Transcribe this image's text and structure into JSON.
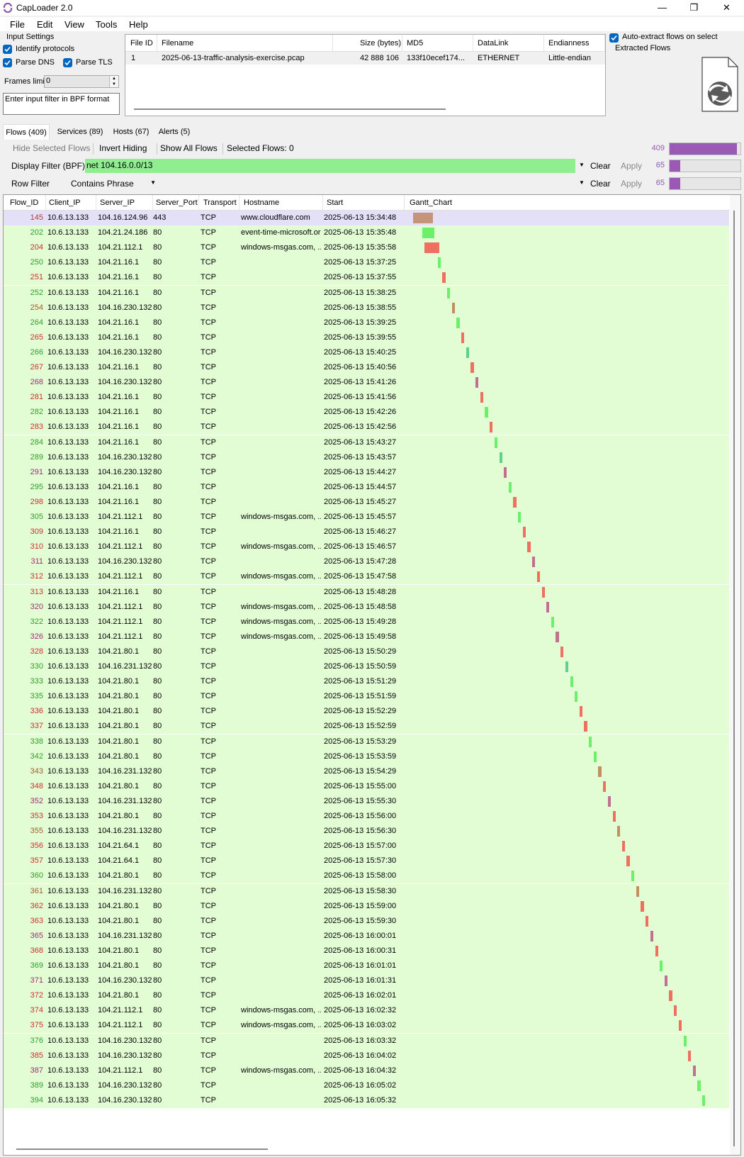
{
  "app": {
    "title": "CapLoader 2.0"
  },
  "window_controls": {
    "minimize": "—",
    "maximize": "❐",
    "close": "✕"
  },
  "menu": [
    "File",
    "Edit",
    "View",
    "Tools",
    "Help"
  ],
  "input_settings": {
    "title": "Input Settings",
    "identify_protocols": "Identify protocols",
    "parse_dns": "Parse DNS",
    "parse_tls": "Parse TLS",
    "frames_limit_label": "Frames limit",
    "frames_limit_value": "0",
    "bpf_placeholder": "Enter input filter in BPF format"
  },
  "file_table": {
    "headers": [
      "File ID",
      "Filename",
      "Size (bytes)",
      "MD5",
      "DataLink",
      "Endianness"
    ],
    "rows": [
      [
        "1",
        "2025-06-13-traffic-analysis-exercise.pcap",
        "42 888 106",
        "133f10ecef174...",
        "ETHERNET",
        "Little-endian"
      ]
    ]
  },
  "auto_extract": {
    "label": "Auto-extract flows on select",
    "extracted_label": "Extracted Flows"
  },
  "tabs": [
    "Flows (409)",
    "Services (89)",
    "Hosts (67)",
    "Alerts (5)"
  ],
  "toolbar": {
    "hide_selected": "Hide Selected Flows",
    "invert_hiding": "Invert Hiding",
    "show_all": "Show All Flows",
    "selected_flows": "Selected Flows:  0",
    "total_count": "409",
    "total_fraction": 0.95
  },
  "display_filter": {
    "label": "Display Filter (BPF)",
    "value": "net 104.16.0.0/13",
    "clear": "Clear",
    "apply": "Apply",
    "count": "65",
    "fraction": 0.15
  },
  "row_filter": {
    "label": "Row Filter",
    "mode": "Contains Phrase",
    "clear": "Clear",
    "apply": "Apply",
    "count": "65",
    "fraction": 0.15
  },
  "flows_table": {
    "headers": [
      "Flow_ID",
      "Client_IP",
      "Server_IP",
      "Server_Port",
      "Transport",
      "Hostname",
      "Start",
      "Gantt_Chart"
    ],
    "rows": [
      [
        "145",
        "10.6.13.133",
        "104.16.124.96",
        "443",
        "TCP",
        "www.cloudflare.com",
        "2025-06-13 15:34:48"
      ],
      [
        "202",
        "10.6.13.133",
        "104.21.24.186",
        "80",
        "TCP",
        "event-time-microsoft.org",
        "2025-06-13 15:35:48"
      ],
      [
        "204",
        "10.6.13.133",
        "104.21.112.1",
        "80",
        "TCP",
        "windows-msgas.com, ...",
        "2025-06-13 15:35:58"
      ],
      [
        "250",
        "10.6.13.133",
        "104.21.16.1",
        "80",
        "TCP",
        "",
        "2025-06-13 15:37:25"
      ],
      [
        "251",
        "10.6.13.133",
        "104.21.16.1",
        "80",
        "TCP",
        "",
        "2025-06-13 15:37:55"
      ],
      [
        "252",
        "10.6.13.133",
        "104.21.16.1",
        "80",
        "TCP",
        "",
        "2025-06-13 15:38:25"
      ],
      [
        "254",
        "10.6.13.133",
        "104.16.230.132",
        "80",
        "TCP",
        "",
        "2025-06-13 15:38:55"
      ],
      [
        "264",
        "10.6.13.133",
        "104.21.16.1",
        "80",
        "TCP",
        "",
        "2025-06-13 15:39:25"
      ],
      [
        "265",
        "10.6.13.133",
        "104.21.16.1",
        "80",
        "TCP",
        "",
        "2025-06-13 15:39:55"
      ],
      [
        "266",
        "10.6.13.133",
        "104.16.230.132",
        "80",
        "TCP",
        "",
        "2025-06-13 15:40:25"
      ],
      [
        "267",
        "10.6.13.133",
        "104.21.16.1",
        "80",
        "TCP",
        "",
        "2025-06-13 15:40:56"
      ],
      [
        "268",
        "10.6.13.133",
        "104.16.230.132",
        "80",
        "TCP",
        "",
        "2025-06-13 15:41:26"
      ],
      [
        "281",
        "10.6.13.133",
        "104.21.16.1",
        "80",
        "TCP",
        "",
        "2025-06-13 15:41:56"
      ],
      [
        "282",
        "10.6.13.133",
        "104.21.16.1",
        "80",
        "TCP",
        "",
        "2025-06-13 15:42:26"
      ],
      [
        "283",
        "10.6.13.133",
        "104.21.16.1",
        "80",
        "TCP",
        "",
        "2025-06-13 15:42:56"
      ],
      [
        "284",
        "10.6.13.133",
        "104.21.16.1",
        "80",
        "TCP",
        "",
        "2025-06-13 15:43:27"
      ],
      [
        "289",
        "10.6.13.133",
        "104.16.230.132",
        "80",
        "TCP",
        "",
        "2025-06-13 15:43:57"
      ],
      [
        "291",
        "10.6.13.133",
        "104.16.230.132",
        "80",
        "TCP",
        "",
        "2025-06-13 15:44:27"
      ],
      [
        "295",
        "10.6.13.133",
        "104.21.16.1",
        "80",
        "TCP",
        "",
        "2025-06-13 15:44:57"
      ],
      [
        "298",
        "10.6.13.133",
        "104.21.16.1",
        "80",
        "TCP",
        "",
        "2025-06-13 15:45:27"
      ],
      [
        "305",
        "10.6.13.133",
        "104.21.112.1",
        "80",
        "TCP",
        "windows-msgas.com, ...",
        "2025-06-13 15:45:57"
      ],
      [
        "309",
        "10.6.13.133",
        "104.21.16.1",
        "80",
        "TCP",
        "",
        "2025-06-13 15:46:27"
      ],
      [
        "310",
        "10.6.13.133",
        "104.21.112.1",
        "80",
        "TCP",
        "windows-msgas.com, ...",
        "2025-06-13 15:46:57"
      ],
      [
        "311",
        "10.6.13.133",
        "104.16.230.132",
        "80",
        "TCP",
        "",
        "2025-06-13 15:47:28"
      ],
      [
        "312",
        "10.6.13.133",
        "104.21.112.1",
        "80",
        "TCP",
        "windows-msgas.com, ...",
        "2025-06-13 15:47:58"
      ],
      [
        "313",
        "10.6.13.133",
        "104.21.16.1",
        "80",
        "TCP",
        "",
        "2025-06-13 15:48:28"
      ],
      [
        "320",
        "10.6.13.133",
        "104.21.112.1",
        "80",
        "TCP",
        "windows-msgas.com, ...",
        "2025-06-13 15:48:58"
      ],
      [
        "322",
        "10.6.13.133",
        "104.21.112.1",
        "80",
        "TCP",
        "windows-msgas.com, ...",
        "2025-06-13 15:49:28"
      ],
      [
        "326",
        "10.6.13.133",
        "104.21.112.1",
        "80",
        "TCP",
        "windows-msgas.com, ...",
        "2025-06-13 15:49:58"
      ],
      [
        "328",
        "10.6.13.133",
        "104.21.80.1",
        "80",
        "TCP",
        "",
        "2025-06-13 15:50:29"
      ],
      [
        "330",
        "10.6.13.133",
        "104.16.231.132",
        "80",
        "TCP",
        "",
        "2025-06-13 15:50:59"
      ],
      [
        "333",
        "10.6.13.133",
        "104.21.80.1",
        "80",
        "TCP",
        "",
        "2025-06-13 15:51:29"
      ],
      [
        "335",
        "10.6.13.133",
        "104.21.80.1",
        "80",
        "TCP",
        "",
        "2025-06-13 15:51:59"
      ],
      [
        "336",
        "10.6.13.133",
        "104.21.80.1",
        "80",
        "TCP",
        "",
        "2025-06-13 15:52:29"
      ],
      [
        "337",
        "10.6.13.133",
        "104.21.80.1",
        "80",
        "TCP",
        "",
        "2025-06-13 15:52:59"
      ],
      [
        "338",
        "10.6.13.133",
        "104.21.80.1",
        "80",
        "TCP",
        "",
        "2025-06-13 15:53:29"
      ],
      [
        "342",
        "10.6.13.133",
        "104.21.80.1",
        "80",
        "TCP",
        "",
        "2025-06-13 15:53:59"
      ],
      [
        "343",
        "10.6.13.133",
        "104.16.231.132",
        "80",
        "TCP",
        "",
        "2025-06-13 15:54:29"
      ],
      [
        "348",
        "10.6.13.133",
        "104.21.80.1",
        "80",
        "TCP",
        "",
        "2025-06-13 15:55:00"
      ],
      [
        "352",
        "10.6.13.133",
        "104.16.231.132",
        "80",
        "TCP",
        "",
        "2025-06-13 15:55:30"
      ],
      [
        "353",
        "10.6.13.133",
        "104.21.80.1",
        "80",
        "TCP",
        "",
        "2025-06-13 15:56:00"
      ],
      [
        "355",
        "10.6.13.133",
        "104.16.231.132",
        "80",
        "TCP",
        "",
        "2025-06-13 15:56:30"
      ],
      [
        "356",
        "10.6.13.133",
        "104.21.64.1",
        "80",
        "TCP",
        "",
        "2025-06-13 15:57:00"
      ],
      [
        "357",
        "10.6.13.133",
        "104.21.64.1",
        "80",
        "TCP",
        "",
        "2025-06-13 15:57:30"
      ],
      [
        "360",
        "10.6.13.133",
        "104.21.80.1",
        "80",
        "TCP",
        "",
        "2025-06-13 15:58:00"
      ],
      [
        "361",
        "10.6.13.133",
        "104.16.231.132",
        "80",
        "TCP",
        "",
        "2025-06-13 15:58:30"
      ],
      [
        "362",
        "10.6.13.133",
        "104.21.80.1",
        "80",
        "TCP",
        "",
        "2025-06-13 15:59:00"
      ],
      [
        "363",
        "10.6.13.133",
        "104.21.80.1",
        "80",
        "TCP",
        "",
        "2025-06-13 15:59:30"
      ],
      [
        "365",
        "10.6.13.133",
        "104.16.231.132",
        "80",
        "TCP",
        "",
        "2025-06-13 16:00:01"
      ],
      [
        "368",
        "10.6.13.133",
        "104.21.80.1",
        "80",
        "TCP",
        "",
        "2025-06-13 16:00:31"
      ],
      [
        "369",
        "10.6.13.133",
        "104.21.80.1",
        "80",
        "TCP",
        "",
        "2025-06-13 16:01:01"
      ],
      [
        "371",
        "10.6.13.133",
        "104.16.230.132",
        "80",
        "TCP",
        "",
        "2025-06-13 16:01:31"
      ],
      [
        "372",
        "10.6.13.133",
        "104.21.80.1",
        "80",
        "TCP",
        "",
        "2025-06-13 16:02:01"
      ],
      [
        "374",
        "10.6.13.133",
        "104.21.112.1",
        "80",
        "TCP",
        "windows-msgas.com, ...",
        "2025-06-13 16:02:32"
      ],
      [
        "375",
        "10.6.13.133",
        "104.21.112.1",
        "80",
        "TCP",
        "windows-msgas.com, ...",
        "2025-06-13 16:03:02"
      ],
      [
        "376",
        "10.6.13.133",
        "104.16.230.132",
        "80",
        "TCP",
        "",
        "2025-06-13 16:03:32"
      ],
      [
        "385",
        "10.6.13.133",
        "104.16.230.132",
        "80",
        "TCP",
        "",
        "2025-06-13 16:04:02"
      ],
      [
        "387",
        "10.6.13.133",
        "104.21.112.1",
        "80",
        "TCP",
        "windows-msgas.com, ...",
        "2025-06-13 16:04:32"
      ],
      [
        "389",
        "10.6.13.133",
        "104.16.230.132",
        "80",
        "TCP",
        "",
        "2025-06-13 16:05:02"
      ],
      [
        "394",
        "10.6.13.133",
        "104.16.230.132",
        "80",
        "TCP",
        "",
        "2025-06-13 16:05:32"
      ]
    ],
    "id_colors": [
      "#b04040",
      "#30a030",
      "#d03030",
      "#30a030",
      "#d03030",
      "#30a030",
      "#a06030",
      "#30a030",
      "#d03030",
      "#30a030",
      "#d03030",
      "#a03070",
      "#d03030",
      "#30a030",
      "#d03030",
      "#30a030",
      "#30a030",
      "#a03070",
      "#30a030",
      "#d03030",
      "#30a030",
      "#d03030",
      "#d03030",
      "#a03070",
      "#d03030",
      "#d03030",
      "#a03070",
      "#30a030",
      "#a03070",
      "#d03030",
      "#30a030",
      "#30a030",
      "#30a030",
      "#d03030",
      "#d03030",
      "#30a030",
      "#30a030",
      "#a06030",
      "#d03030",
      "#a03070",
      "#d03030",
      "#a06030",
      "#d03030",
      "#d03030",
      "#30a030",
      "#a06030",
      "#d03030",
      "#d03030",
      "#a03070",
      "#d03030",
      "#30a030",
      "#a03070",
      "#d03030",
      "#d03030",
      "#d03030",
      "#30a030",
      "#d03030",
      "#a03070",
      "#30a030",
      "#30a030"
    ],
    "gantt_colors": [
      "#c4957a",
      "#6cf06c",
      "#f07060",
      "#6cf06c",
      "#f07060",
      "#6cf06c",
      "#c09060",
      "#6cf06c",
      "#f07060",
      "#60d090",
      "#f07060",
      "#c07090",
      "#f07060",
      "#6cf06c",
      "#f07060",
      "#6cf06c",
      "#60d090",
      "#c07090",
      "#6cf06c",
      "#f07060",
      "#6cf06c",
      "#f07060",
      "#f07060",
      "#c07090",
      "#f07060",
      "#f07060",
      "#c07090",
      "#6cf06c",
      "#c07090",
      "#f07060",
      "#60d090",
      "#6cf06c",
      "#6cf06c",
      "#f07060",
      "#f07060",
      "#6cf06c",
      "#6cf06c",
      "#c09060",
      "#f07060",
      "#c07090",
      "#f07060",
      "#c09060",
      "#f07060",
      "#f07060",
      "#6cf06c",
      "#c09060",
      "#f07060",
      "#f07060",
      "#c07090",
      "#f07060",
      "#6cf06c",
      "#c07090",
      "#f07060",
      "#f07060",
      "#f07060",
      "#6cf06c",
      "#f07060",
      "#c07090",
      "#6cf06c",
      "#6cf06c"
    ],
    "gantt_start_min": [
      0,
      1,
      1.17,
      2.62,
      3.12,
      3.62,
      4.12,
      4.62,
      5.12,
      5.62,
      6.13,
      6.63,
      7.13,
      7.63,
      8.13,
      8.65,
      9.15,
      9.65,
      10.15,
      10.65,
      11.15,
      11.65,
      12.15,
      12.67,
      13.17,
      13.67,
      14.17,
      14.67,
      15.17,
      15.68,
      16.18,
      16.68,
      17.18,
      17.68,
      18.18,
      18.68,
      19.18,
      19.68,
      20.2,
      20.7,
      21.2,
      21.7,
      22.2,
      22.7,
      23.2,
      23.7,
      24.2,
      24.7,
      25.22,
      25.72,
      26.22,
      26.72,
      27.22,
      27.73,
      28.23,
      28.73,
      29.23,
      29.73,
      30.23,
      30.73
    ],
    "gantt_dur_min": [
      1.3,
      0.8,
      1.0,
      0.2,
      0.2,
      0.2,
      0.2,
      0.2,
      0.2,
      0.2,
      0.2,
      0.2,
      0.2,
      0.2,
      0.2,
      0.2,
      0.2,
      0.2,
      0.2,
      0.2,
      0.2,
      0.2,
      0.2,
      0.2,
      0.2,
      0.2,
      0.2,
      0.2,
      0.2,
      0.2,
      0.2,
      0.2,
      0.2,
      0.2,
      0.2,
      0.2,
      0.2,
      0.2,
      0.2,
      0.2,
      0.2,
      0.2,
      0.2,
      0.2,
      0.2,
      0.2,
      0.2,
      0.2,
      0.2,
      0.2,
      0.2,
      0.2,
      0.2,
      0.2,
      0.2,
      0.2,
      0.2,
      0.2,
      0.2,
      0.2
    ]
  }
}
